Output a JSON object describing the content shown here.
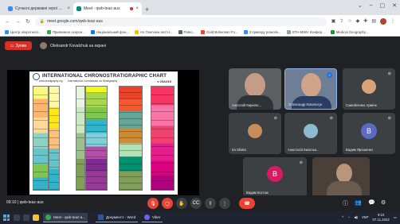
{
  "browser": {
    "tabs": [
      {
        "label": "Сучасні державні герої ...",
        "favicon_color": "#4285f4",
        "active": false
      },
      {
        "label": "Meet - qwb-teaz-aus",
        "favicon_color": "#00897b",
        "active": true
      }
    ],
    "url": "meet.google.com/qwb-teaz-aus",
    "bookmarks": [
      {
        "label": "Центр зворотного...",
        "color": "#4285f4"
      },
      {
        "label": "Припинено охорон...",
        "color": "#34a853"
      },
      {
        "label": "Національний фон...",
        "color": "#1a73e8"
      },
      {
        "label": "An Overview and H...",
        "color": "#fbbc04"
      },
      {
        "label": "Paleo...",
        "color": "#5f6368"
      },
      {
        "label": "Gold Bohemian Fo...",
        "color": "#ea4335"
      },
      {
        "label": "З приводу розкопк...",
        "color": "#4285f4"
      },
      {
        "label": "STH-MWH Конфер...",
        "color": "#9aa0a6"
      },
      {
        "label": "Medical Geography...",
        "color": "#1e8e3e"
      }
    ]
  },
  "meet": {
    "present_label": "Зупин",
    "presenter_name": "Oleksandr Kovalchuk на екрані",
    "code": "qwb-teaz-aus",
    "time": "09:10",
    "participants": [
      {
        "name": "Анатолій Кирилю...",
        "type": "video",
        "tone": "#6b6f73"
      },
      {
        "name": "Олександр Ковальчук",
        "type": "video",
        "tone": "#5a6e88",
        "highlight": true
      },
      {
        "name": "Самойленко Арміне",
        "type": "avatar-photo",
        "tone": "#d8a37a"
      },
      {
        "name": "Ira Shako",
        "type": "avatar-photo",
        "tone": "#c88c5a"
      },
      {
        "name": "Анастасія Кисельо...",
        "type": "avatar-photo",
        "tone": "#8bbad1"
      },
      {
        "name": "Вадим Ярошенко",
        "type": "initial",
        "initial": "В",
        "tone": "#5c6bc0"
      },
      {
        "name": "Вадим Костюк",
        "type": "initial",
        "initial": "В",
        "tone": "#d81b60"
      },
      {
        "name": "",
        "type": "video",
        "tone": "#4a3f39"
      }
    ]
  },
  "slide": {
    "title": "INTERNATIONAL CHRONOSTRATIGRAPHIC CHART",
    "site": "www.stratigraphy.org",
    "org": "International Commission on Stratigraphy",
    "version": "v 2022/10"
  },
  "taskbar": {
    "apps": [
      {
        "label": "Meet - qwb-teaz-a...",
        "color": "#34a853"
      },
      {
        "label": "Документ1 - Word",
        "color": "#2b579a"
      },
      {
        "label": "Viber",
        "color": "#7360f2"
      }
    ],
    "lang": "УКР",
    "time": "9:10",
    "date": "07.11.2022"
  }
}
